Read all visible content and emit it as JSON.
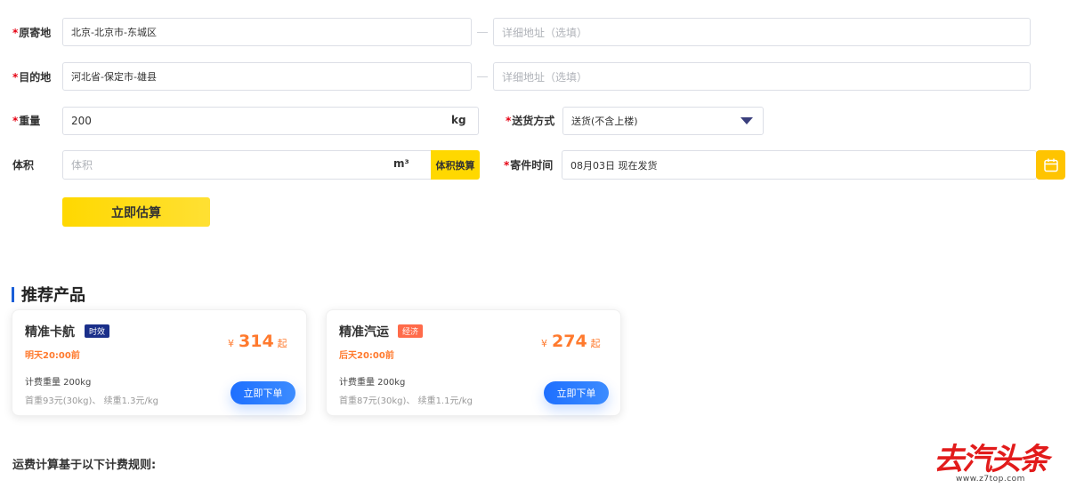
{
  "form": {
    "origin": {
      "label": "原寄地",
      "region": "北京-北京市-东城区",
      "detail_placeholder": "详细地址（选填）"
    },
    "destination": {
      "label": "目的地",
      "region": "河北省-保定市-雄县",
      "detail_placeholder": "详细地址（选填）"
    },
    "weight": {
      "label": "重量",
      "value": "200",
      "unit": "kg"
    },
    "delivery": {
      "label": "送货方式",
      "value": "送货(不含上楼)"
    },
    "volume": {
      "label": "体积",
      "placeholder": "体积",
      "unit": "m³",
      "convert_button": "体积换算"
    },
    "send_time": {
      "label": "寄件时间",
      "value": "08月03日 现在发货"
    },
    "required_mark": "*",
    "estimate_button": "立即估算"
  },
  "recommend": {
    "title": "推荐产品",
    "products": [
      {
        "name": "精准卡航",
        "badge": "时效",
        "badge_color": "#1a2f8a",
        "eta": "明天20:00前",
        "currency": "¥",
        "price": "314",
        "price_suffix": "起",
        "weight": "计费重量 200kg",
        "rule": "首重93元(30kg)、 续重1.3元/kg",
        "order_button": "立即下单"
      },
      {
        "name": "精准汽运",
        "badge": "经济",
        "badge_color": "#ff6b4a",
        "eta": "后天20:00前",
        "currency": "¥",
        "price": "274",
        "price_suffix": "起",
        "weight": "计费重量 200kg",
        "rule": "首重87元(30kg)、 续重1.1元/kg",
        "order_button": "立即下单"
      }
    ]
  },
  "rules_title": "运费计算基于以下计费规则:",
  "watermark": {
    "text": "去汽头条",
    "url": "www.z7top.com"
  },
  "icons": {
    "calendar": "calendar-icon",
    "dropdown": "chevron-down-icon"
  }
}
